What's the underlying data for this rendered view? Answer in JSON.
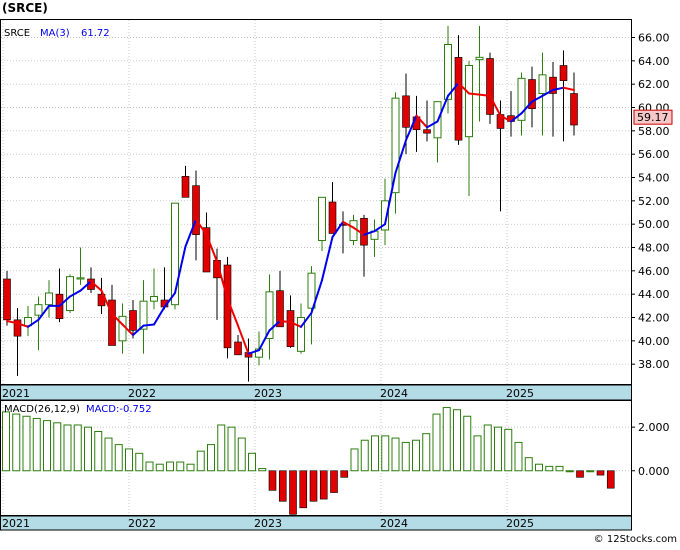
{
  "title": "(SRCE)",
  "watermark": "© 12Stocks.com",
  "colors": {
    "up": "#2e7d0f",
    "down": "#e00000",
    "ma_up": "#0000ee",
    "ma_down": "#ee0000",
    "axis_band": "#b4dce6",
    "price_label_bg": "#f6c8c8"
  },
  "chart_data": [
    {
      "type": "candlestick",
      "legend": {
        "symbol": "SRCE",
        "ma_label": "MA(3)",
        "ma_value": "61.72"
      },
      "ylim": [
        36.3,
        67.5
      ],
      "yticks": [
        "38.00",
        "40.00",
        "42.00",
        "44.00",
        "46.00",
        "48.00",
        "50.00",
        "52.00",
        "54.00",
        "56.00",
        "58.00",
        "60.00",
        "62.00",
        "64.00",
        "66.00"
      ],
      "last_price": "59.17",
      "x_labels": [
        {
          "label": "2021",
          "index": 0
        },
        {
          "label": "2022",
          "index": 12
        },
        {
          "label": "2023",
          "index": 24
        },
        {
          "label": "2024",
          "index": 36
        },
        {
          "label": "2025",
          "index": 48
        }
      ],
      "candles": [
        [
          45.3,
          46.0,
          41.3,
          41.8
        ],
        [
          41.8,
          42.8,
          37.0,
          40.4
        ],
        [
          41.3,
          43.0,
          40.4,
          42.0
        ],
        [
          42.2,
          43.8,
          39.2,
          43.1
        ],
        [
          43.1,
          45.2,
          42.0,
          44.1
        ],
        [
          44.0,
          46.2,
          41.6,
          41.9
        ],
        [
          42.6,
          45.7,
          42.4,
          45.5
        ],
        [
          45.3,
          48.0,
          44.8,
          45.4
        ],
        [
          45.3,
          46.3,
          44.1,
          44.4
        ],
        [
          44.0,
          45.4,
          42.3,
          43.0
        ],
        [
          43.5,
          44.8,
          40.4,
          39.6
        ],
        [
          40.0,
          43.2,
          38.9,
          42.1
        ],
        [
          42.6,
          43.5,
          40.2,
          40.9
        ],
        [
          41.0,
          45.2,
          38.9,
          43.4
        ],
        [
          43.4,
          46.2,
          42.7,
          43.8
        ],
        [
          43.5,
          46.3,
          42.7,
          42.9
        ],
        [
          43.1,
          46.8,
          42.7,
          51.8
        ],
        [
          54.1,
          55.0,
          52.7,
          52.3
        ],
        [
          53.3,
          54.6,
          46.9,
          49.1
        ],
        [
          49.7,
          51.0,
          46.6,
          45.9
        ],
        [
          46.9,
          47.9,
          41.8,
          45.4
        ],
        [
          46.5,
          47.2,
          38.5,
          39.4
        ],
        [
          39.9,
          40.5,
          39.0,
          38.8
        ],
        [
          39.0,
          40.2,
          36.5,
          38.6
        ],
        [
          38.6,
          40.8,
          37.9,
          39.3
        ],
        [
          40.2,
          45.7,
          38.4,
          44.2
        ],
        [
          44.3,
          46.0,
          41.7,
          41.2
        ],
        [
          42.6,
          43.9,
          39.4,
          39.5
        ],
        [
          39.1,
          43.2,
          38.9,
          42.0
        ],
        [
          42.8,
          46.4,
          39.7,
          45.8
        ],
        [
          48.6,
          52.1,
          47.7,
          52.3
        ],
        [
          51.9,
          53.6,
          49.5,
          49.2
        ],
        [
          50.0,
          51.1,
          47.5,
          49.9
        ],
        [
          48.6,
          50.8,
          48.2,
          50.3
        ],
        [
          50.5,
          50.8,
          45.5,
          48.2
        ],
        [
          48.7,
          50.4,
          47.2,
          49.4
        ],
        [
          49.5,
          53.9,
          48.2,
          52.0
        ],
        [
          52.7,
          61.3,
          50.9,
          60.8
        ],
        [
          61.0,
          62.9,
          56.0,
          58.3
        ],
        [
          59.2,
          61.0,
          56.2,
          58.1
        ],
        [
          58.1,
          60.6,
          57.1,
          57.8
        ],
        [
          57.4,
          58.6,
          55.3,
          60.5
        ],
        [
          60.7,
          67.0,
          59.5,
          65.4
        ],
        [
          64.3,
          66.2,
          56.8,
          57.2
        ],
        [
          57.5,
          64.0,
          52.4,
          63.6
        ],
        [
          64.1,
          67.0,
          58.8,
          64.3
        ],
        [
          64.2,
          64.7,
          58.6,
          59.4
        ],
        [
          59.4,
          60.6,
          51.1,
          58.2
        ],
        [
          59.3,
          61.4,
          57.5,
          58.8
        ],
        [
          58.9,
          63.0,
          57.6,
          62.5
        ],
        [
          62.4,
          63.5,
          58.3,
          59.9
        ],
        [
          61.2,
          64.7,
          57.6,
          62.8
        ],
        [
          62.6,
          63.9,
          57.5,
          61.2
        ],
        [
          63.6,
          64.9,
          57.1,
          62.3
        ],
        [
          61.2,
          63.0,
          57.6,
          58.5
        ]
      ],
      "ma": [
        41.7,
        41.5,
        41.2,
        41.8,
        43.0,
        43.0,
        43.8,
        44.3,
        45.1,
        44.3,
        42.3,
        41.4,
        40.5,
        41.3,
        41.4,
        42.9,
        44.1,
        48.1,
        50.4,
        49.1,
        46.8,
        43.6,
        41.3,
        38.9,
        39.2,
        40.9,
        41.7,
        41.6,
        41.2,
        42.4,
        45.2,
        48.9,
        50.2,
        49.7,
        49.1,
        49.4,
        50.0,
        54.4,
        57.2,
        59.3,
        58.3,
        58.8,
        61.0,
        62.1,
        61.2,
        61.1,
        61.0,
        59.3,
        58.8,
        59.5,
        60.5,
        61.0,
        61.5,
        61.7,
        61.5
      ]
    },
    {
      "type": "bar",
      "legend": {
        "label": "MACD(26,12,9)",
        "value_label": "MACD:-0.752"
      },
      "ylim": [
        -2.03,
        3.2
      ],
      "yticks": [
        "0.000",
        "2.000"
      ],
      "x_labels": [
        {
          "label": "2021",
          "index": 0
        },
        {
          "label": "2022",
          "index": 12
        },
        {
          "label": "2023",
          "index": 24
        },
        {
          "label": "2024",
          "index": 36
        },
        {
          "label": "2025",
          "index": 48
        }
      ],
      "values": [
        2.7,
        2.6,
        2.5,
        2.4,
        2.3,
        2.2,
        2.1,
        2.1,
        2.0,
        1.8,
        1.5,
        1.2,
        1.0,
        0.8,
        0.4,
        0.3,
        0.4,
        0.4,
        0.3,
        0.9,
        1.2,
        2.1,
        2.0,
        1.5,
        0.8,
        0.1,
        -0.9,
        -1.4,
        -2.0,
        -1.7,
        -1.4,
        -1.3,
        -1.0,
        -0.3,
        1.0,
        1.4,
        1.6,
        1.6,
        1.5,
        1.3,
        1.4,
        1.7,
        2.6,
        2.9,
        2.8,
        2.5,
        1.6,
        2.1,
        2.0,
        1.9,
        1.3,
        0.6,
        0.3,
        0.2,
        0.2,
        0.0,
        -0.3,
        0.0,
        -0.2,
        -0.8
      ]
    }
  ]
}
